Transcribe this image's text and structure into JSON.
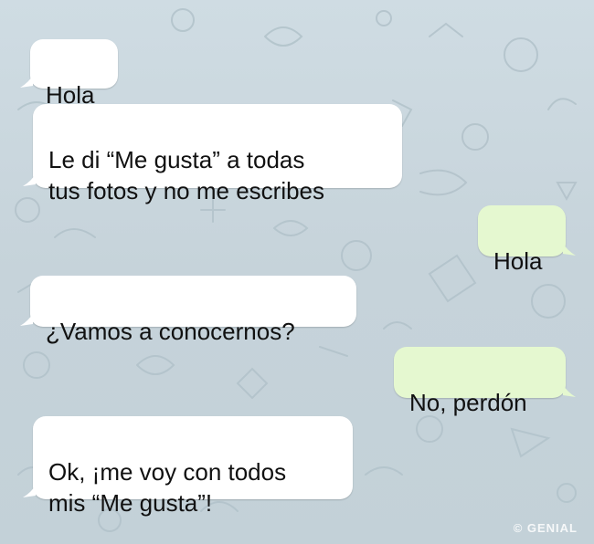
{
  "messages": [
    {
      "text": "Hola",
      "direction": "incoming"
    },
    {
      "text": "Le di “Me gusta” a todas\ntus fotos y no me escribes",
      "direction": "incoming"
    },
    {
      "text": "Hola",
      "direction": "outgoing"
    },
    {
      "text": "¿Vamos a conocernos?",
      "direction": "incoming"
    },
    {
      "text": "No, perdón",
      "direction": "outgoing"
    },
    {
      "text": "Ok, ¡me voy con todos\nmis “Me gusta”!",
      "direction": "incoming"
    }
  ],
  "watermark": "© GENIAL",
  "colors": {
    "background": "#c9d6dc",
    "incoming_bubble": "#ffffff",
    "outgoing_bubble": "#e5f8d0"
  }
}
